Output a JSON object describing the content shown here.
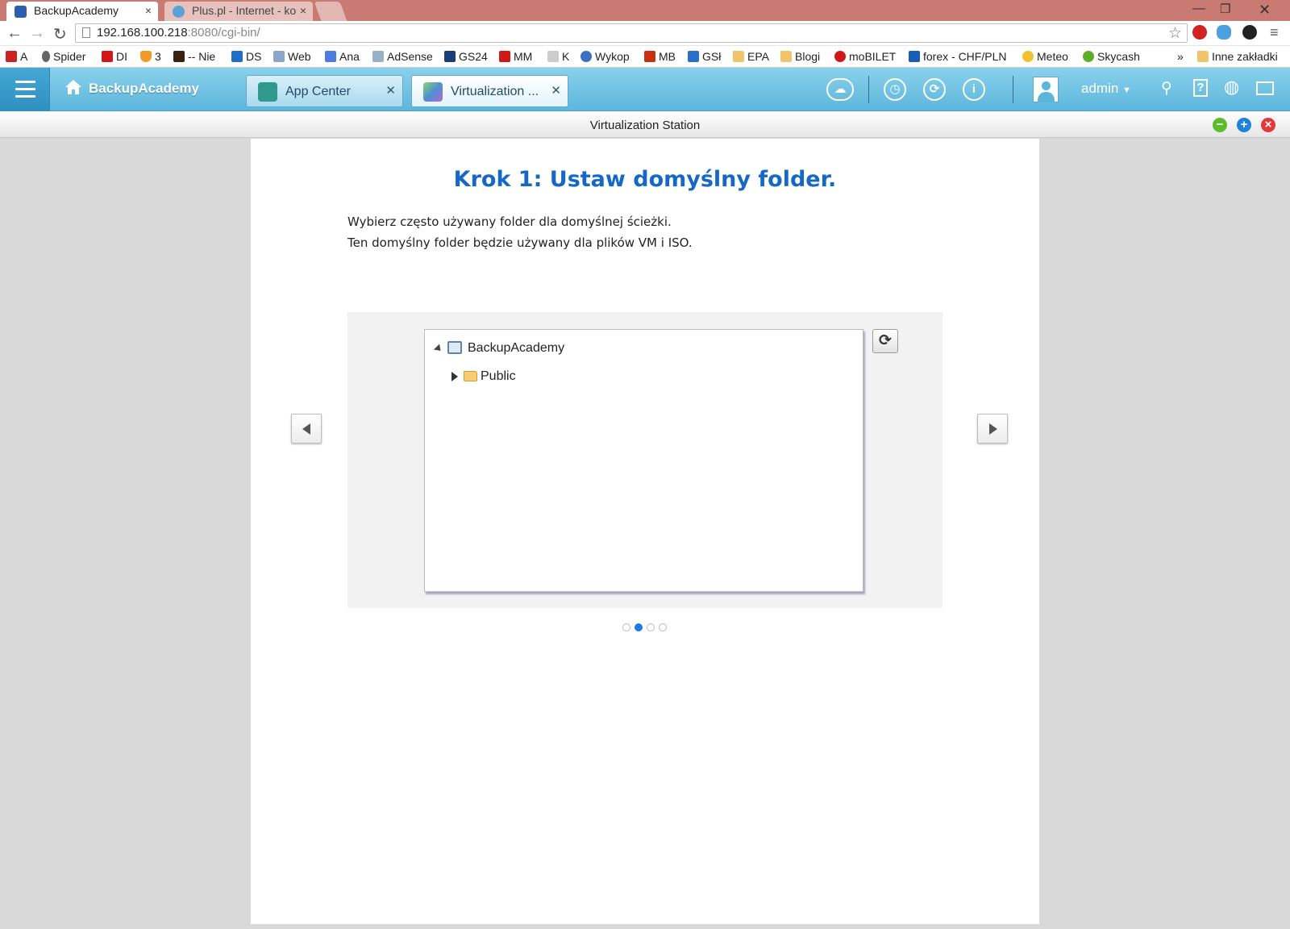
{
  "browser": {
    "tabs": [
      {
        "title": "BackupAcademy",
        "active": true
      },
      {
        "title": "Plus.pl - Internet - ko",
        "active": false
      }
    ],
    "url_host": "192.168.100.218",
    "url_rest": ":8080/cgi-bin/",
    "bookmarks": [
      {
        "label": "A",
        "icon": "red-badge-icon"
      },
      {
        "label": "Spider",
        "icon": "spider-icon"
      },
      {
        "label": "DI",
        "icon": "di-icon"
      },
      {
        "label": "3",
        "icon": "shield-icon"
      },
      {
        "label": "-- Nie",
        "icon": "dark-icon"
      },
      {
        "label": "DS",
        "icon": "dsm-icon"
      },
      {
        "label": "Web",
        "icon": "web-icon"
      },
      {
        "label": "Ana",
        "icon": "google-icon"
      },
      {
        "label": "AdSense",
        "icon": "adsense-icon"
      },
      {
        "label": "GS24",
        "icon": "gs-icon"
      },
      {
        "label": "MM",
        "icon": "mm-icon"
      },
      {
        "label": "K",
        "icon": "k-icon"
      },
      {
        "label": "Wykop",
        "icon": "wykop-icon"
      },
      {
        "label": "MB",
        "icon": "mb-icon"
      },
      {
        "label": "GSł",
        "icon": "gsl-icon"
      },
      {
        "label": "EPA",
        "icon": "folder-icon"
      },
      {
        "label": "Blogi",
        "icon": "folder-icon"
      },
      {
        "label": "moBILET",
        "icon": "mobilet-icon"
      },
      {
        "label": "forex - CHF/PLN",
        "icon": "m-icon"
      },
      {
        "label": "Meteo",
        "icon": "weather-icon"
      },
      {
        "label": "Skycash",
        "icon": "skycash-icon"
      }
    ],
    "more_bookmarks": "»",
    "other_bookmarks": "Inne zakładki"
  },
  "qnap": {
    "home_label": "BackupAcademy",
    "tabs": [
      {
        "label": "App Center"
      },
      {
        "label": "Virtualization ..."
      }
    ],
    "user": "admin"
  },
  "window": {
    "title": "Virtualization Station"
  },
  "wizard": {
    "heading": "Krok 1: Ustaw domyślny folder.",
    "desc_line1": "Wybierz często używany folder dla domyślnej ścieżki.",
    "desc_line2": "Ten domyślny folder będzie używany dla plików VM i ISO.",
    "tree": {
      "root": "BackupAcademy",
      "child": "Public"
    },
    "pages": 4,
    "current_page": 2
  },
  "colors": {
    "accent": "#1568c5",
    "qnap_bar": "#5cb6dc",
    "active_dot": "#1a7be0"
  }
}
